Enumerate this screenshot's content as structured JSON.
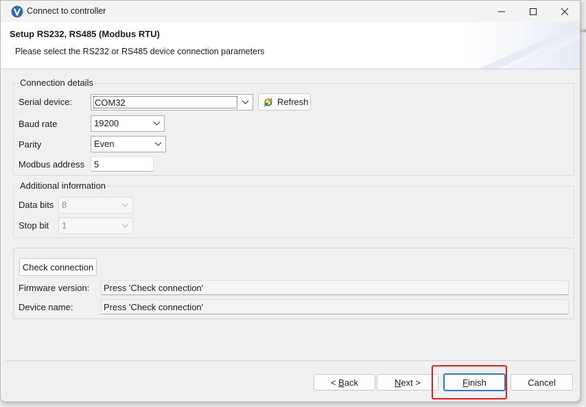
{
  "window": {
    "title": "Connect to controller",
    "edge_text": "ca"
  },
  "header": {
    "title": "Setup RS232, RS485 (Modbus RTU)",
    "subtitle": "Please select the RS232 or RS485 device connection parameters"
  },
  "connection": {
    "legend": "Connection details",
    "serial_label": "Serial device:",
    "serial_value": "COM32",
    "refresh_label": "Refresh",
    "baud_label": "Baud rate",
    "baud_value": "19200",
    "parity_label": "Parity",
    "parity_value": "Even",
    "address_label": "Modbus address",
    "address_value": "5"
  },
  "additional": {
    "legend": "Additional information",
    "databits_label": "Data bits",
    "databits_value": "8",
    "stopbit_label": "Stop bit",
    "stopbit_value": "1"
  },
  "check": {
    "button_label": "Check connection",
    "firmware_label": "Firmware version:",
    "firmware_value": "Press 'Check connection'",
    "device_label": "Device name:",
    "device_value": "Press 'Check connection'"
  },
  "footer": {
    "back_mnemonic": "B",
    "back_rest": "ack",
    "next_mnemonic": "N",
    "next_rest": "ext >",
    "finish_mnemonic": "F",
    "finish_rest": "inish",
    "cancel_label": "Cancel"
  },
  "colors": {
    "accent": "#2f79c7",
    "highlight": "#ea1b1b",
    "logo": "#2b6cb0"
  }
}
